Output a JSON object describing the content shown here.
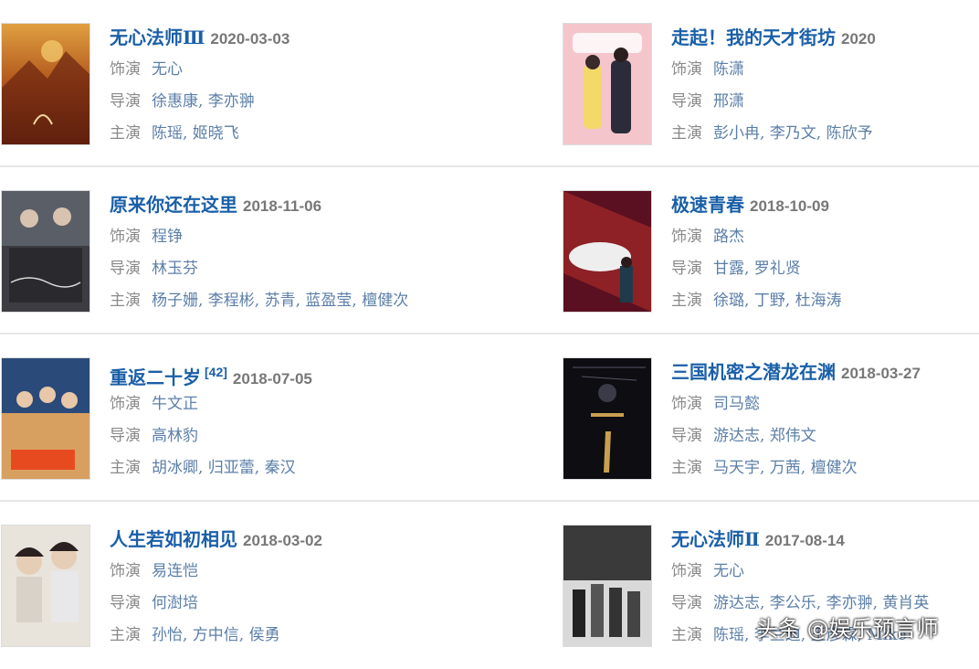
{
  "labels": {
    "role": "饰演",
    "director": "导演",
    "stars": "主演"
  },
  "colors": {
    "title": "#1a5fa8",
    "link": "#5c7fa8",
    "label": "#8a8a8a",
    "date": "#777777"
  },
  "items": [
    {
      "title": "无心法师Ⅲ",
      "ref": "",
      "date": "2020-03-03",
      "role": "无心",
      "director": "徐惠康, 李亦翀",
      "stars": "陈瑶, 姬晓飞"
    },
    {
      "title": "走起！我的天才街坊",
      "ref": "",
      "date": "2020",
      "role": "陈潇",
      "director": "邢潇",
      "stars": "彭小冉, 李乃文, 陈欣予"
    },
    {
      "title": "原来你还在这里",
      "ref": "",
      "date": "2018-11-06",
      "role": "程铮",
      "director": "林玉芬",
      "stars": "杨子姗, 李程彬, 苏青, 蓝盈莹, 檀健次"
    },
    {
      "title": "极速青春",
      "ref": "",
      "date": "2018-10-09",
      "role": "路杰",
      "director": "甘露, 罗礼贤",
      "stars": "徐璐, 丁野, 杜海涛"
    },
    {
      "title": "重返二十岁",
      "ref": "[42]",
      "date": "2018-07-05",
      "role": "牛文正",
      "director": "高林豹",
      "stars": "胡冰卿, 归亚蕾, 秦汉"
    },
    {
      "title": "三国机密之潜龙在渊",
      "ref": "",
      "date": "2018-03-27",
      "role": "司马懿",
      "director": "游达志, 郑伟文",
      "stars": "马天宇, 万茜, 檀健次"
    },
    {
      "title": "人生若如初相见",
      "ref": "",
      "date": "2018-03-02",
      "role": "易连恺",
      "director": "何澍培",
      "stars": "孙怡, 方中信, 侯勇"
    },
    {
      "title": "无心法师Ⅱ",
      "ref": "",
      "date": "2017-08-14",
      "role": "无心",
      "director": "游达志, 李公乐, 李亦翀, 黄肖英",
      "stars": "陈瑶, 李兰迪, 王彦霖, Mike"
    }
  ],
  "watermark": "头条 @娱乐预言师"
}
